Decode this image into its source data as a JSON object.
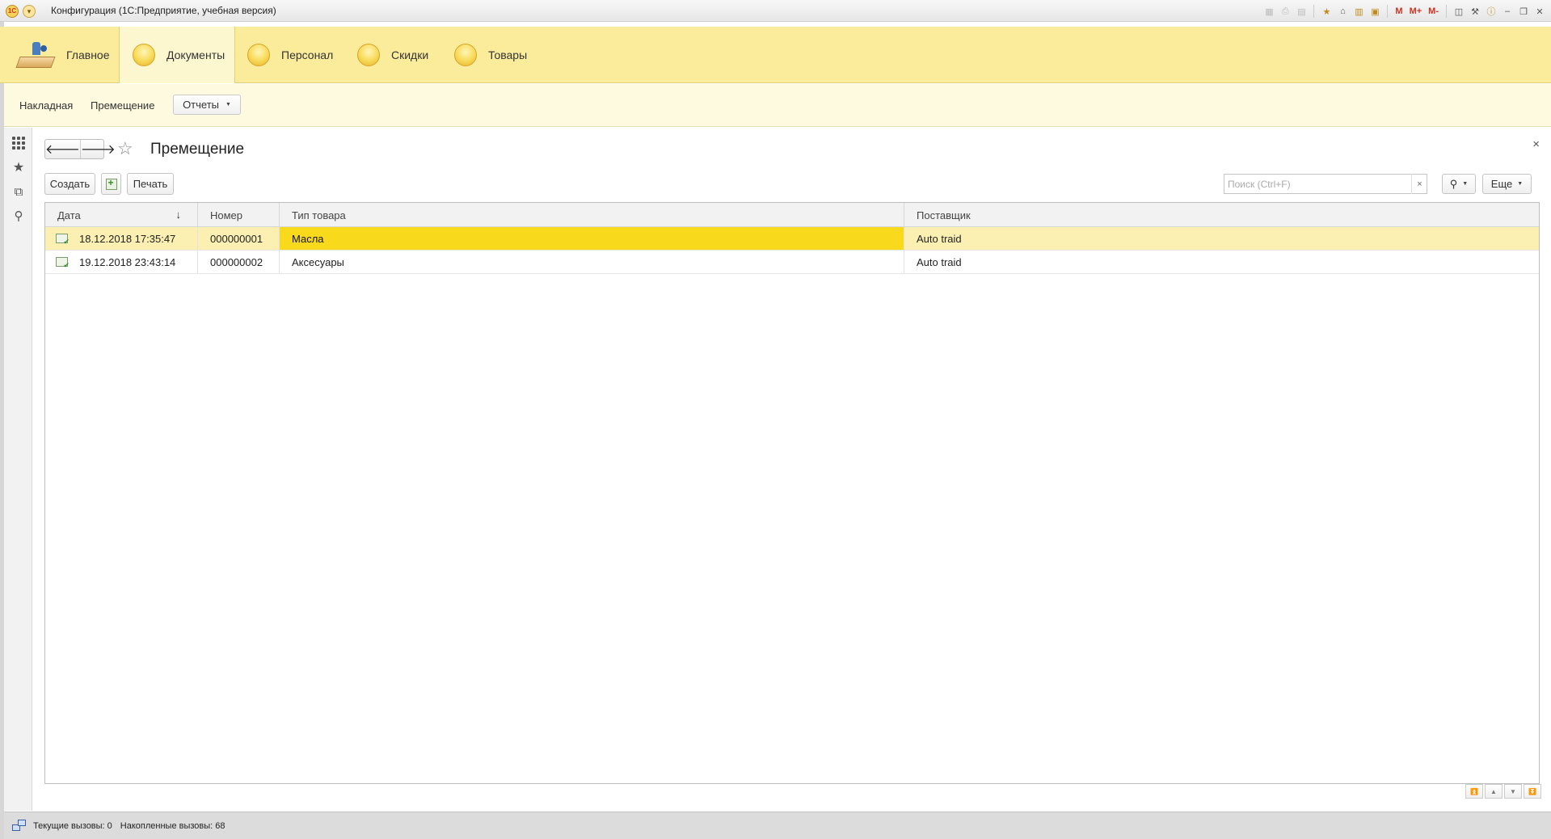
{
  "window": {
    "logo": "1C",
    "menu_icon": "chevron-down-icon",
    "title": "Конфигурация  (1С:Предприятие, учебная версия)",
    "tb_icons": {
      "m": "M",
      "m_plus": "M+",
      "m_minus": "M-"
    }
  },
  "sections": [
    {
      "label": "Главное"
    },
    {
      "label": "Документы",
      "active": true
    },
    {
      "label": "Персонал"
    },
    {
      "label": "Скидки"
    },
    {
      "label": "Товары"
    }
  ],
  "subpanel": {
    "links": [
      "Накладная",
      "Премещение"
    ],
    "reports_label": "Отчеты"
  },
  "form": {
    "title": "Премещение",
    "close": "×",
    "buttons": {
      "create": "Создать",
      "print": "Печать",
      "more": "Еще"
    },
    "search": {
      "placeholder": "Поиск (Ctrl+F)",
      "clear": "×"
    }
  },
  "table": {
    "columns": [
      "Дата",
      "Номер",
      "Тип товара",
      "Поставщик"
    ],
    "sort_indicator": "↓",
    "rows": [
      {
        "date": "18.12.2018 17:35:47",
        "number": "000000001",
        "type": "Масла",
        "supplier": "Auto traid",
        "selected": true
      },
      {
        "date": "19.12.2018 23:43:14",
        "number": "000000002",
        "type": "Аксесуары",
        "supplier": "Auto traid",
        "selected": false
      }
    ]
  },
  "status": {
    "current_calls": "Текущие вызовы: 0",
    "accumulated_calls": "Накопленные вызовы: 68"
  },
  "colors": {
    "section_bg": "#fbec9b",
    "subpanel_bg": "#fdfae0",
    "selected_row": "#fbf0b2",
    "active_cell": "#f8d91c"
  }
}
